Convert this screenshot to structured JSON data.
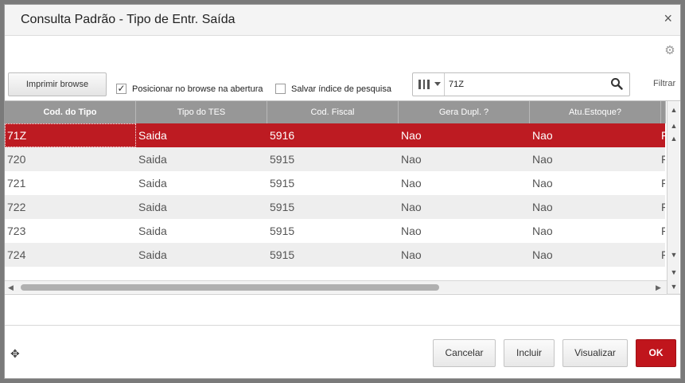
{
  "dialog": {
    "title": "Consulta Padrão - Tipo de Entr. Saída",
    "close_glyph": "×"
  },
  "toolbar": {
    "print_label": "Imprimir browse",
    "position_label": "Posicionar no browse na abertura",
    "position_checked": true,
    "save_index_label": "Salvar índice de pesquisa",
    "save_index_checked": false,
    "search_value": "71Z",
    "filter_label": "Filtrar"
  },
  "table": {
    "columns": [
      "Cod. do Tipo",
      "Tipo do TES",
      "Cod. Fiscal",
      "Gera Dupl. ?",
      "Atu.Estoque?"
    ],
    "rows": [
      {
        "c0": "71Z",
        "c1": "Saida",
        "c2": "5916",
        "c3": "Nao",
        "c4": "Nao",
        "c5": "F"
      },
      {
        "c0": "720",
        "c1": "Saida",
        "c2": "5915",
        "c3": "Nao",
        "c4": "Nao",
        "c5": "F"
      },
      {
        "c0": "721",
        "c1": "Saida",
        "c2": "5915",
        "c3": "Nao",
        "c4": "Nao",
        "c5": "F"
      },
      {
        "c0": "722",
        "c1": "Saida",
        "c2": "5915",
        "c3": "Nao",
        "c4": "Nao",
        "c5": "F"
      },
      {
        "c0": "723",
        "c1": "Saida",
        "c2": "5915",
        "c3": "Nao",
        "c4": "Nao",
        "c5": "F"
      },
      {
        "c0": "724",
        "c1": "Saida",
        "c2": "5915",
        "c3": "Nao",
        "c4": "Nao",
        "c5": "F"
      }
    ],
    "selected_row": 0
  },
  "footer": {
    "cancel_label": "Cancelar",
    "include_label": "Incluir",
    "view_label": "Visualizar",
    "ok_label": "OK"
  },
  "colors": {
    "accent": "#c0151c",
    "header_bg": "#979797"
  },
  "icons": [
    "close-icon",
    "gear-icon",
    "column-select-icon",
    "search-icon",
    "move-icon"
  ]
}
